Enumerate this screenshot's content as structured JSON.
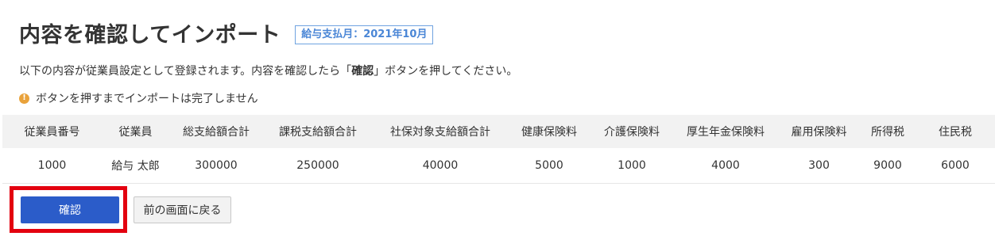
{
  "header": {
    "title": "内容を確認してインポート",
    "badge": "給与支払月：2021年10月"
  },
  "description": {
    "before": "以下の内容が従業員設定として登録されます。内容を確認したら「",
    "bold": "確認",
    "after": "」ボタンを押してください。"
  },
  "notice": {
    "text": "ボタンを押すまでインポートは完了しません"
  },
  "table": {
    "headers": [
      "従業員番号",
      "従業員",
      "総支給額合計",
      "課税支給額合計",
      "社保対象支給額合計",
      "健康保険料",
      "介護保険料",
      "厚生年金保険料",
      "雇用保険料",
      "所得税",
      "住民税"
    ],
    "rows": [
      [
        "1000",
        "給与 太郎",
        "300000",
        "250000",
        "40000",
        "5000",
        "1000",
        "4000",
        "300",
        "9000",
        "6000"
      ]
    ]
  },
  "actions": {
    "confirm_label": "確認",
    "back_label": "前の画面に戻る"
  },
  "colors": {
    "accent": "#2b5cc9",
    "highlight": "#e3000f",
    "badge": "#4a86d6",
    "warning": "#e9a23b"
  }
}
